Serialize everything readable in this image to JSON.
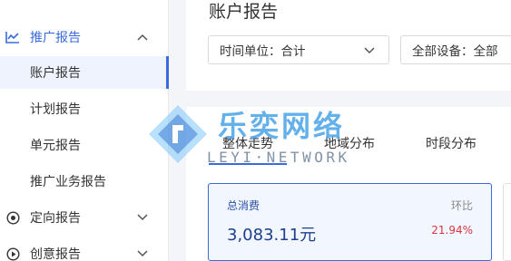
{
  "sidebar": {
    "group_promo": {
      "label": "推广报告",
      "icon": "trend-chart-icon",
      "expanded": true
    },
    "sub_items": [
      {
        "label": "账户报告",
        "active": true
      },
      {
        "label": "计划报告",
        "active": false
      },
      {
        "label": "单元报告",
        "active": false
      },
      {
        "label": "推广业务报告",
        "active": false
      }
    ],
    "group_targeting": {
      "label": "定向报告",
      "icon": "target-icon"
    },
    "group_creative": {
      "label": "创意报告",
      "icon": "creative-icon"
    }
  },
  "header": {
    "title": "账户报告",
    "time_select": "时间单位：合计",
    "device_select": "全部设备：全部"
  },
  "tabs": [
    {
      "label": "整体走势",
      "active": true
    },
    {
      "label": "地域分布",
      "active": false
    },
    {
      "label": "时段分布",
      "active": false
    }
  ],
  "metric": {
    "label": "总消费",
    "value": "3,083.11元",
    "compare_label": "环比",
    "compare_value": "21.94%"
  },
  "watermark": {
    "cn": "乐奕网络",
    "en": "LEYI·NETWORK"
  },
  "colors": {
    "accent": "#3a6bdc",
    "negative": "#d9363e"
  }
}
